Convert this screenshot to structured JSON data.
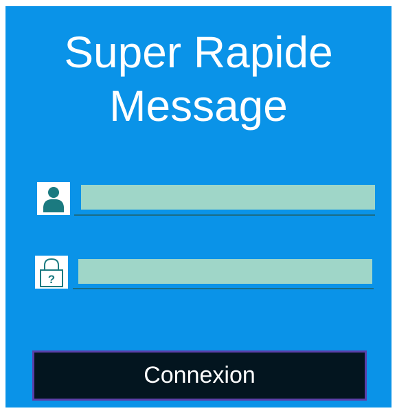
{
  "app": {
    "title_line1": "Super Rapide",
    "title_line2": "Message"
  },
  "login": {
    "username_icon": "user-icon",
    "username_value": "",
    "username_placeholder": "",
    "password_icon": "padlock-question-icon",
    "password_value": "",
    "password_placeholder": "",
    "submit_label": "Connexion"
  },
  "colors": {
    "background": "#0a93e8",
    "field": "#9fd6c8",
    "button": "#03151f",
    "button_border": "#5b3fa8",
    "icon": "#1b7a80"
  }
}
